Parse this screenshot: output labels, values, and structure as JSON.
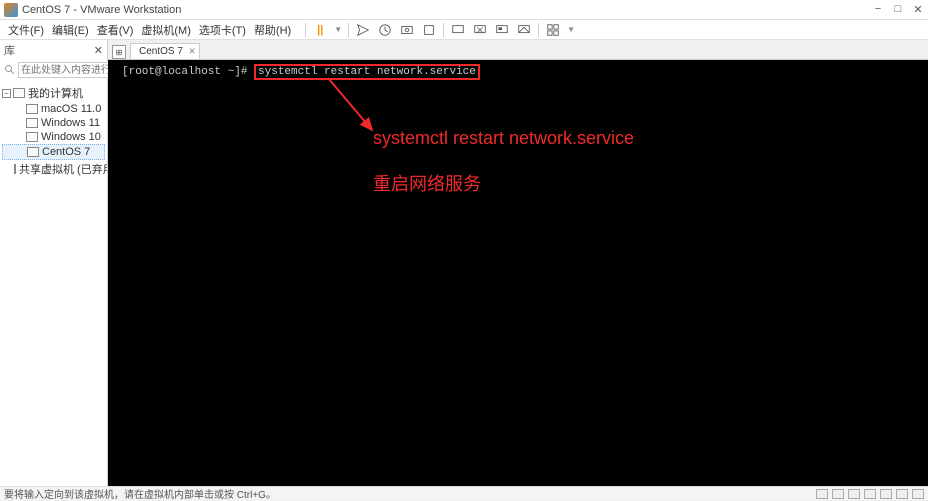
{
  "window": {
    "title": "CentOS 7 - VMware Workstation"
  },
  "menu": {
    "file": "文件(F)",
    "edit": "编辑(E)",
    "view": "查看(V)",
    "vm": "虚拟机(M)",
    "tabs": "选项卡(T)",
    "help": "帮助(H)"
  },
  "sidebar": {
    "header": "库",
    "search_placeholder": "在此处键入内容进行搜索",
    "root": "我的计算机",
    "items": [
      "macOS 11.0",
      "Windows 11",
      "Windows 10",
      "CentOS 7"
    ],
    "shared": "共享虚拟机 (已弃用)"
  },
  "tab": {
    "label": "CentOS 7"
  },
  "terminal": {
    "prompt": "[root@localhost ~]#",
    "command": "systemctl restart network.service"
  },
  "annotation": {
    "line1": "systemctl restart network.service",
    "line2": "重启网络服务"
  },
  "status": {
    "text": "要将输入定向到该虚拟机，请在虚拟机内部单击或按 Ctrl+G。"
  }
}
